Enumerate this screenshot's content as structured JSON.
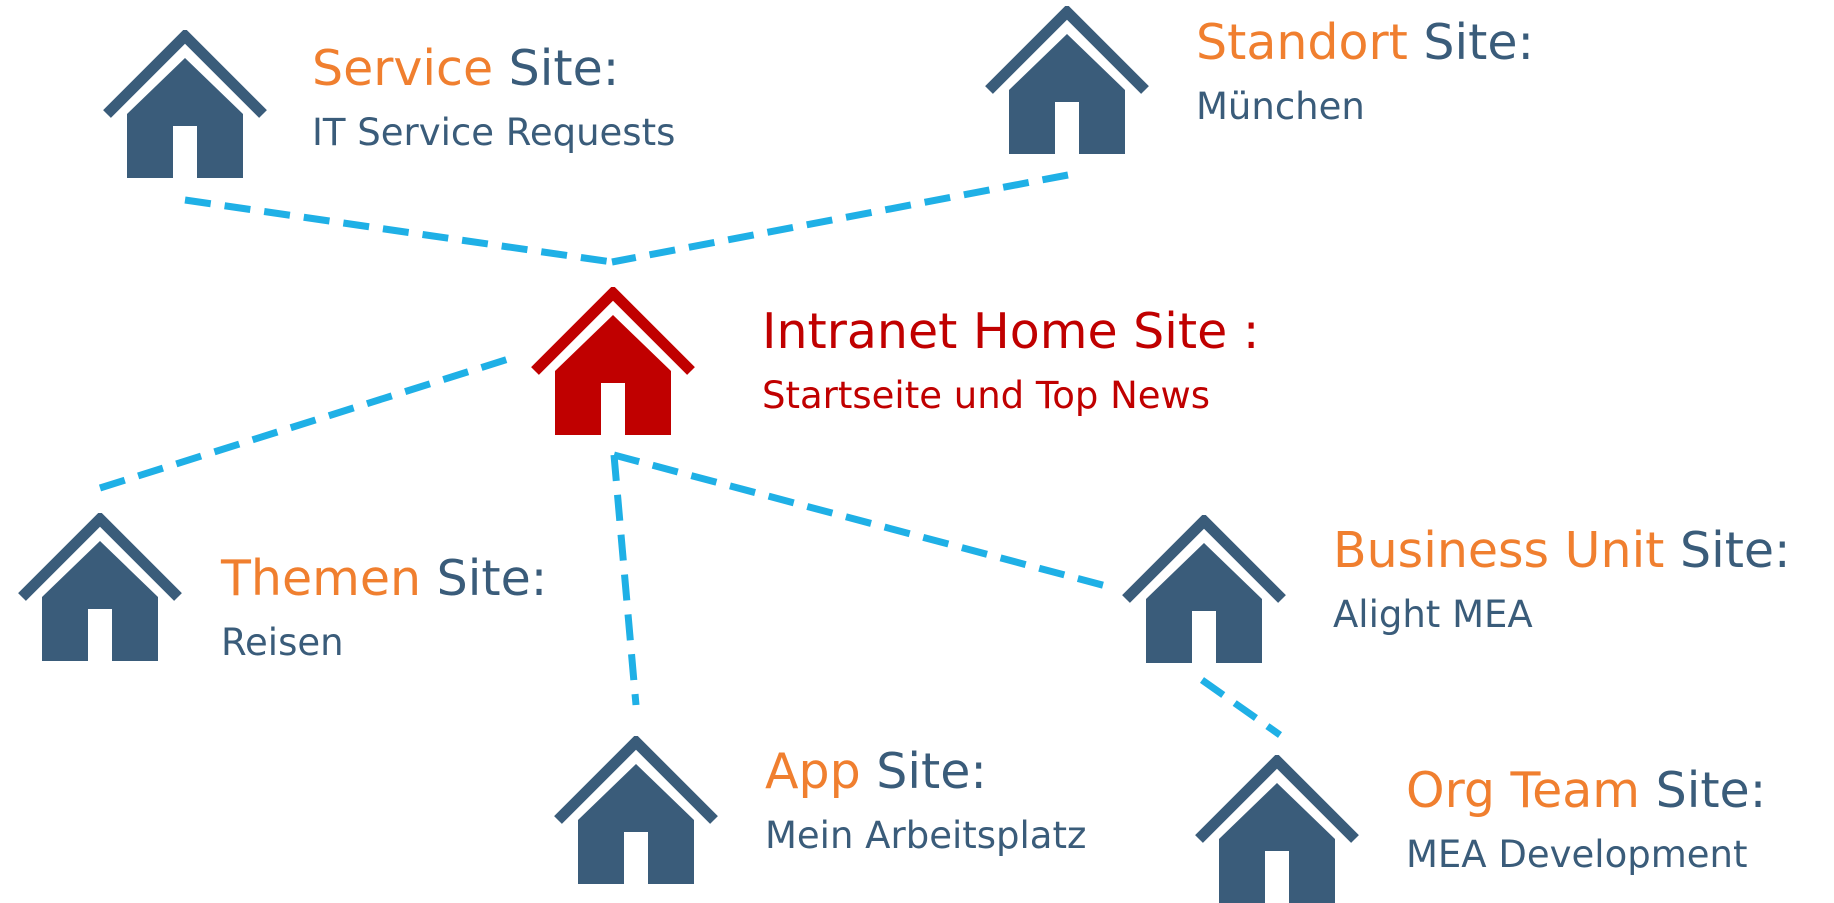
{
  "colors": {
    "house": "#3a5c7a",
    "home_house": "#c00000",
    "accent": "#f07f2f",
    "text": "#3a5c7a",
    "home_text": "#c00000",
    "connector": "#1fb0e6"
  },
  "nodes": {
    "service": {
      "accent": "Service",
      "suffix": " Site:",
      "subtitle": "IT Service Requests",
      "icon": "house-icon"
    },
    "standort": {
      "accent": "Standort",
      "suffix": " Site:",
      "subtitle": "München",
      "icon": "house-icon"
    },
    "home": {
      "title": "Intranet Home Site :",
      "subtitle": "Startseite und Top News",
      "icon": "house-icon"
    },
    "themen": {
      "accent": "Themen",
      "suffix": " Site:",
      "subtitle": "Reisen",
      "icon": "house-icon"
    },
    "business": {
      "accent": "Business Unit",
      "suffix": " Site:",
      "subtitle": "Alight MEA",
      "icon": "house-icon"
    },
    "app": {
      "accent": "App",
      "suffix": " Site:",
      "subtitle": "Mein Arbeitsplatz",
      "icon": "house-icon"
    },
    "orgteam": {
      "accent": "Org Team",
      "suffix": " Site:",
      "subtitle": "MEA Development",
      "icon": "house-icon"
    }
  },
  "connections": [
    [
      "service",
      "home"
    ],
    [
      "standort",
      "home"
    ],
    [
      "themen",
      "home"
    ],
    [
      "app",
      "home"
    ],
    [
      "business",
      "home"
    ],
    [
      "orgteam",
      "business"
    ]
  ]
}
